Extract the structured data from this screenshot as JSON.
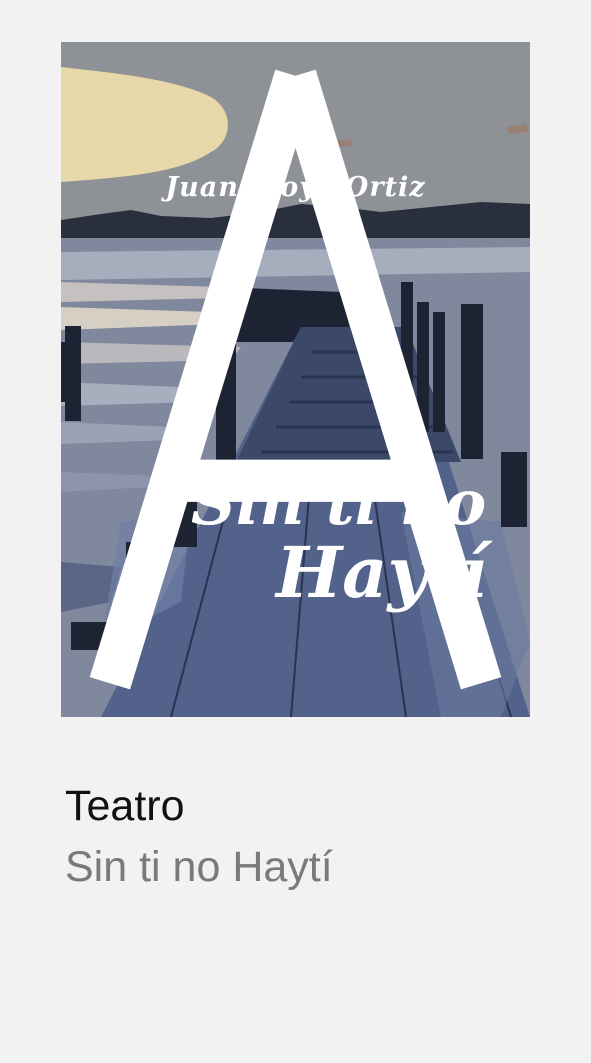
{
  "book": {
    "cover": {
      "author": "Juan Moya Ortiz",
      "title_line_1": "Sin ti no",
      "title_line_2": "Haytí"
    },
    "category": "Teatro",
    "title": "Sin ti no Haytí"
  },
  "colors": {
    "background": "#f2f2f2",
    "category_text": "#111111",
    "title_text": "#7a7a7a",
    "sky": "#8e9196",
    "cloud": "#e6d8a8",
    "water": "#7f889c",
    "pier": "#4f5f86",
    "dark": "#1e2333"
  }
}
